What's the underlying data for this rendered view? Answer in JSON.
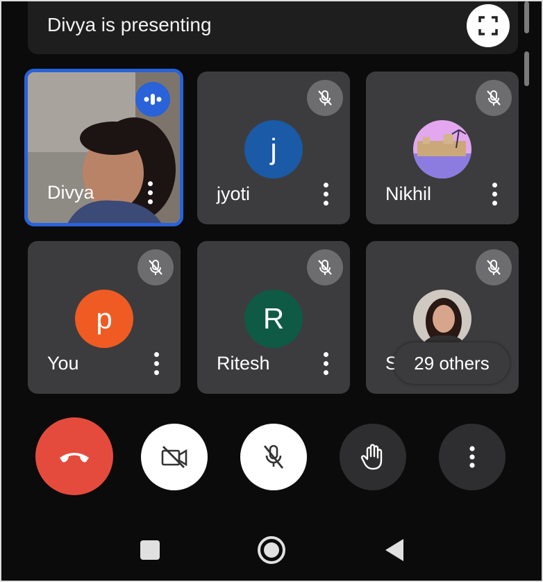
{
  "presentation": {
    "status_text": "Divya is presenting",
    "fullscreen_icon": "fullscreen-icon"
  },
  "participants": [
    {
      "name": "Divya",
      "status": "speaking",
      "has_video": true,
      "avatar_letter": "",
      "avatar_color": ""
    },
    {
      "name": "jyoti",
      "status": "muted",
      "has_video": false,
      "avatar_letter": "j",
      "avatar_color": "#1a5aa6"
    },
    {
      "name": "Nikhil",
      "status": "muted",
      "has_video": false,
      "avatar_letter": "",
      "avatar_color": "#b46ad6"
    },
    {
      "name": "You",
      "status": "muted",
      "has_video": false,
      "avatar_letter": "p",
      "avatar_color": "#ef5b22"
    },
    {
      "name": "Ritesh",
      "status": "muted",
      "has_video": false,
      "avatar_letter": "R",
      "avatar_color": "#0f5a44"
    },
    {
      "name": "Sw",
      "status": "muted",
      "has_video": false,
      "avatar_letter": "",
      "avatar_color": "#8a7a70"
    }
  ],
  "others_label": "29 others",
  "controls": {
    "end_call_icon": "end-call-icon",
    "camera_icon": "camera-off-icon",
    "mic_icon": "mic-off-icon",
    "hand_icon": "raise-hand-icon",
    "more_icon": "more-options-icon"
  },
  "colors": {
    "accent_blue": "#2962d9",
    "end_call_red": "#e54b3c",
    "tile_bg": "#3c3c3e"
  },
  "system_nav": [
    "recents-button",
    "home-button",
    "back-button"
  ]
}
